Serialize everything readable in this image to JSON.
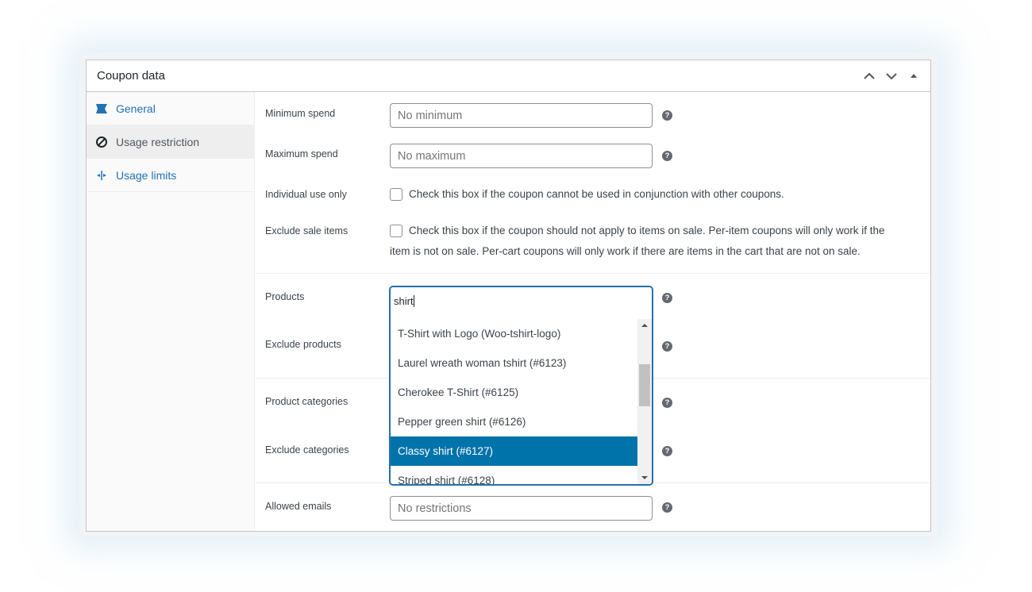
{
  "panel": {
    "title": "Coupon data"
  },
  "header_tools": [
    {
      "name": "move-up-icon"
    },
    {
      "name": "move-down-icon"
    },
    {
      "name": "toggle-panel-icon"
    }
  ],
  "tabs": [
    {
      "label": "General",
      "icon": "ticket-icon",
      "active": false
    },
    {
      "label": "Usage restriction",
      "icon": "restriction-icon",
      "active": true
    },
    {
      "label": "Usage limits",
      "icon": "limits-icon",
      "active": false
    }
  ],
  "fields": {
    "minimum_spend": {
      "label": "Minimum spend",
      "placeholder": "No minimum"
    },
    "maximum_spend": {
      "label": "Maximum spend",
      "placeholder": "No maximum"
    },
    "individual_use": {
      "label": "Individual use only",
      "text": "Check this box if the coupon cannot be used in conjunction with other coupons."
    },
    "exclude_sale": {
      "label": "Exclude sale items",
      "text_line1": "Check this box if the coupon should not apply to items on sale. Per-item coupons will only work if the",
      "text_line2": "item is not on sale. Per-cart coupons will only work if there are items in the cart that are not on sale."
    },
    "products": {
      "label": "Products"
    },
    "exclude_products": {
      "label": "Exclude products"
    },
    "product_categories": {
      "label": "Product categories"
    },
    "exclude_categories": {
      "label": "Exclude categories"
    },
    "allowed_emails": {
      "label": "Allowed emails",
      "placeholder": "No restrictions"
    }
  },
  "dropdown": {
    "search_value": "shirt",
    "items": [
      {
        "label": "T-Shirt with Logo (Woo-tshirt-logo)",
        "highlighted": false
      },
      {
        "label": "Laurel wreath woman tshirt (#6123)",
        "highlighted": false
      },
      {
        "label": "Cherokee T-Shirt (#6125)",
        "highlighted": false
      },
      {
        "label": "Pepper green shirt (#6126)",
        "highlighted": false
      },
      {
        "label": "Classy shirt (#6127)",
        "highlighted": true
      },
      {
        "label": "Striped shirt (#6128)",
        "highlighted": false
      }
    ]
  },
  "help_symbol": "?",
  "colors": {
    "link": "#2271b1",
    "highlight": "#0073aa",
    "border": "#c3c4c7"
  }
}
